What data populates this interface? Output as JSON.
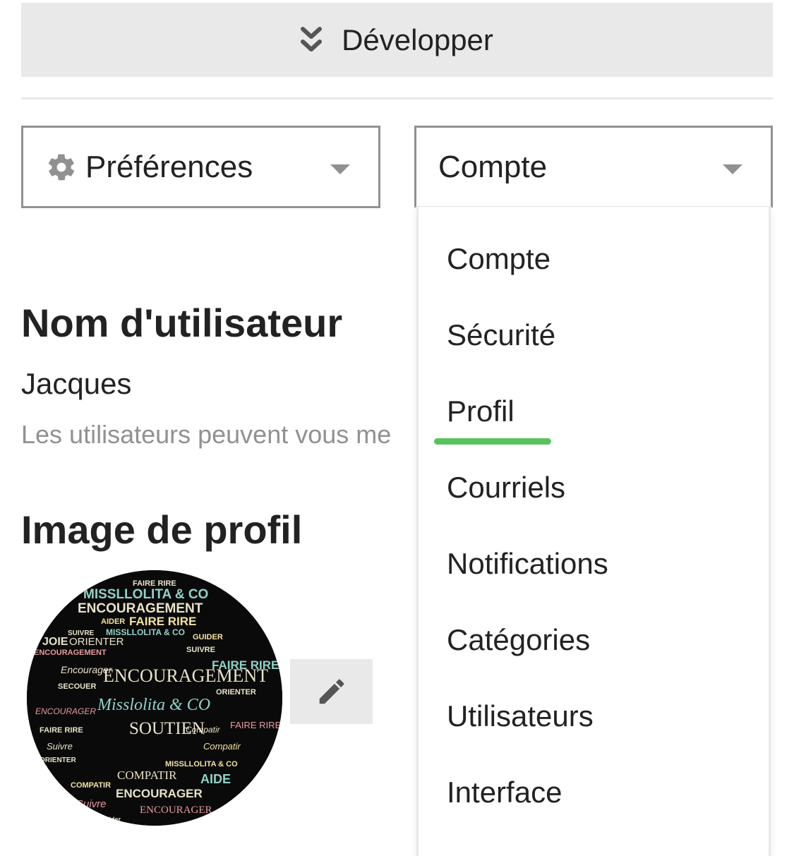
{
  "expand": {
    "label": "Développer",
    "icon": "double-chevron-down-icon"
  },
  "preferences_select": {
    "label": "Préférences",
    "icon": "gear-icon"
  },
  "account_select": {
    "label": "Compte"
  },
  "menu": {
    "items": [
      {
        "label": "Compte"
      },
      {
        "label": "Sécurité"
      },
      {
        "label": "Profil",
        "active": true
      },
      {
        "label": "Courriels"
      },
      {
        "label": "Notifications"
      },
      {
        "label": "Catégories"
      },
      {
        "label": "Utilisateurs"
      },
      {
        "label": "Interface"
      }
    ]
  },
  "username": {
    "title": "Nom d'utilisateur",
    "value": "Jacques",
    "description": "Les utilisateurs peuvent vous me"
  },
  "avatar": {
    "title": "Image de profil",
    "words": [
      "FAIRE RIRE",
      "MISSLLOLITA & CO",
      "ENCOURAGEMENT",
      "AIDER",
      "SUIVRE",
      "JOIE",
      "ORIENTER",
      "GUIDER",
      "SECOUER",
      "Encourager",
      "Misslolita & CO",
      "SOUTIEN",
      "Compatir",
      "COMPATIR",
      "AIDE",
      "ENCOURAGER",
      "Suivre",
      "Aider"
    ],
    "edit_icon": "pencil-icon"
  },
  "colors": {
    "accent_green": "#58c35e",
    "button_bg": "#e9e9e9",
    "border": "#919191",
    "text": "#222222",
    "muted": "#919191"
  }
}
